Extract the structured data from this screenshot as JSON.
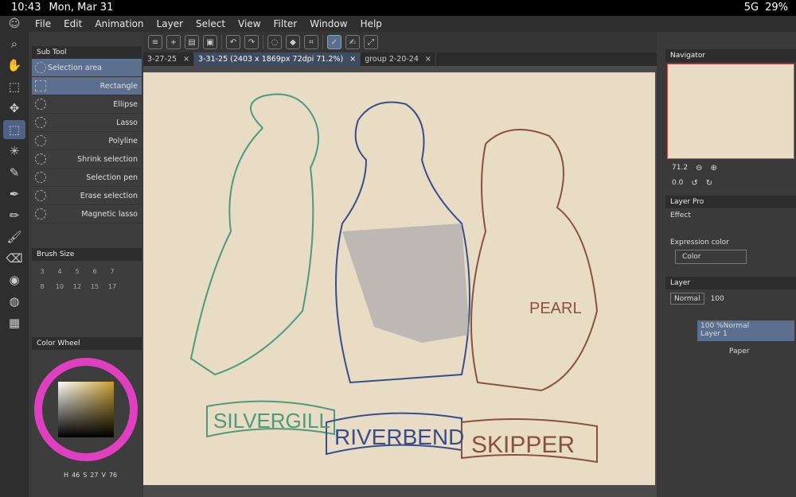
{
  "status": {
    "time": "10:43",
    "date": "Mon, Mar 31",
    "network": "5G",
    "battery": "29%"
  },
  "menu": [
    "File",
    "Edit",
    "Animation",
    "Layer",
    "Select",
    "View",
    "Filter",
    "Window",
    "Help"
  ],
  "tabs": [
    {
      "label": "3-27-25"
    },
    {
      "label": "3-31-25 (2403 x 1869px 72dpi 71.2%)"
    },
    {
      "label": "group 2-20-24"
    }
  ],
  "subtool": {
    "title": "Sub Tool",
    "items": [
      "Selection area",
      "Rectangle",
      "Ellipse",
      "Lasso",
      "Polyline",
      "Shrink selection",
      "Selection pen",
      "Erase selection",
      "Magnetic lasso"
    ]
  },
  "brush": {
    "title": "Brush Size",
    "sizes": [
      "",
      "",
      "",
      "",
      "",
      "",
      "3",
      "4",
      "5",
      "6",
      "7",
      "",
      "8",
      "10",
      "12",
      "15",
      "17",
      "",
      ""
    ]
  },
  "colorwheel": {
    "title": "Color Wheel",
    "h": "46",
    "s": "27",
    "v": "76",
    "h_label": "H",
    "s_label": "S",
    "v_label": "V"
  },
  "navigator": {
    "title": "Navigator",
    "zoom": "71.2",
    "rotation": "0.0"
  },
  "layerprop": {
    "title": "Layer Pro",
    "effect": "Effect",
    "expression_label": "Expression color",
    "expression_value": "Color"
  },
  "layer": {
    "title": "Layer",
    "blend": "Normal",
    "opacity": "100",
    "layers": [
      {
        "name": "Layer 1",
        "info": "100 %Normal"
      },
      {
        "name": "Paper",
        "info": ""
      }
    ]
  },
  "artwork": {
    "label1": "SILVERGILL",
    "label2": "RIVERBEND",
    "label3": "SKIPPER",
    "label4": "PEARL"
  }
}
